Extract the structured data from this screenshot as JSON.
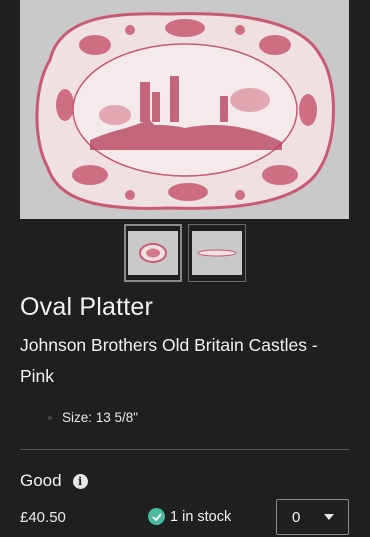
{
  "product": {
    "title": "Oval Platter",
    "subtitle": "Johnson Brothers Old Britain Castles - Pink",
    "spec": "Size: 13 5/8\""
  },
  "gallery": {
    "main_image": "oval-platter-photo",
    "thumbnails": [
      "platter-top-view",
      "platter-side-view"
    ]
  },
  "purchase": {
    "condition": "Good",
    "price": "£40.50",
    "stock": "1 in stock",
    "quantity": "0"
  },
  "colors": {
    "background": "#1f1f1f",
    "text": "#f2f2f2",
    "stock_check": "#4db8a0",
    "transferware_pink": "#c85a72"
  }
}
